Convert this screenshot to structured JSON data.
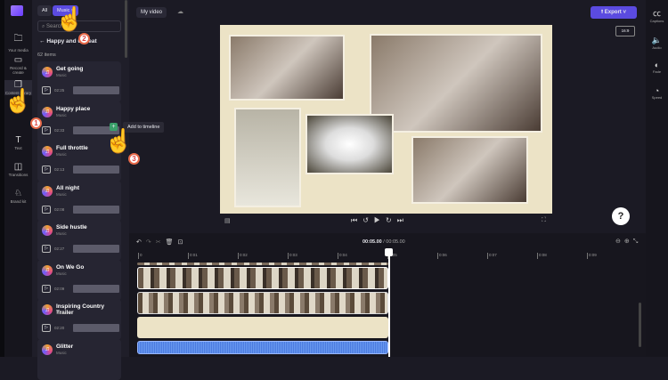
{
  "rail": [
    {
      "label": "Your media",
      "icon": "folder-icon"
    },
    {
      "label": "Record & create",
      "icon": "camera-icon"
    },
    {
      "label": "Content library",
      "icon": "library-icon"
    },
    {
      "label": "Text",
      "icon": "text-icon"
    },
    {
      "label": "Transitions",
      "icon": "transitions-icon"
    },
    {
      "label": "Brand kit",
      "icon": "brand-icon"
    }
  ],
  "panel": {
    "chip_all": "All",
    "chip_music": "Music",
    "chip_close": "×",
    "search_placeholder": "Search",
    "back_title": "Happy and upbeat",
    "count": "62 items",
    "tooltip": "Add to timeline",
    "items": [
      {
        "title": "Get going",
        "sub": "Music",
        "dur": "02:25"
      },
      {
        "title": "Happy place",
        "sub": "Music",
        "dur": "02:33"
      },
      {
        "title": "Full throttle",
        "sub": "Music",
        "dur": "02:13"
      },
      {
        "title": "All night",
        "sub": "Music",
        "dur": "02:08"
      },
      {
        "title": "Side hustle",
        "sub": "Music",
        "dur": "02:27"
      },
      {
        "title": "On We Go",
        "sub": "Music",
        "dur": "02:09"
      },
      {
        "title": "Inspiring Country Trailer",
        "sub": "Music",
        "dur": "02:20"
      },
      {
        "title": "Glitter",
        "sub": "Music",
        "dur": ""
      }
    ]
  },
  "steps": [
    "1",
    "2",
    "3"
  ],
  "topbar": {
    "title": "My video",
    "export": "Export",
    "ratio": "16:9"
  },
  "timeline": {
    "current": "00:05.00",
    "total": "/ 00:05.00",
    "ticks": [
      "0",
      "0:01",
      "0:02",
      "0:03",
      "0:04",
      "0:05",
      "0:06",
      "0:07",
      "0:08",
      "0:09"
    ]
  },
  "rightrail": [
    {
      "label": "Captions",
      "icon": "cc-icon"
    },
    {
      "label": "Audio",
      "icon": "speaker-icon"
    },
    {
      "label": "Fade",
      "icon": "fade-icon"
    },
    {
      "label": "Speed",
      "icon": "speed-icon"
    }
  ],
  "help": "?"
}
